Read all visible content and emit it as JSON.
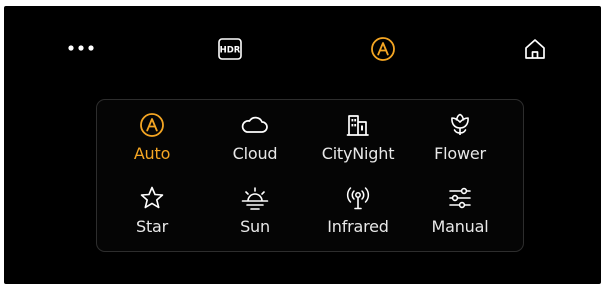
{
  "colors": {
    "accent": "#f5a623",
    "text": "#e8e8e8",
    "background": "#000000",
    "panel_border": "#2d2d2d"
  },
  "toolbar": {
    "more_icon": "more-dots-icon",
    "hdr_icon": "hdr-icon",
    "hdr_label": "HDR",
    "auto_icon": "auto-mode-icon",
    "auto_glyph": "A",
    "home_icon": "home-icon"
  },
  "modes": [
    {
      "label": "Auto",
      "icon": "auto-mode-icon",
      "glyph": "A",
      "selected": true
    },
    {
      "label": "Cloud",
      "icon": "cloud-icon",
      "selected": false
    },
    {
      "label": "CityNight",
      "icon": "city-night-icon",
      "selected": false
    },
    {
      "label": "Flower",
      "icon": "flower-icon",
      "selected": false
    },
    {
      "label": "Star",
      "icon": "star-icon",
      "selected": false
    },
    {
      "label": "Sun",
      "icon": "sun-icon",
      "selected": false
    },
    {
      "label": "Infrared",
      "icon": "infrared-icon",
      "selected": false
    },
    {
      "label": "Manual",
      "icon": "manual-sliders-icon",
      "selected": false
    }
  ]
}
